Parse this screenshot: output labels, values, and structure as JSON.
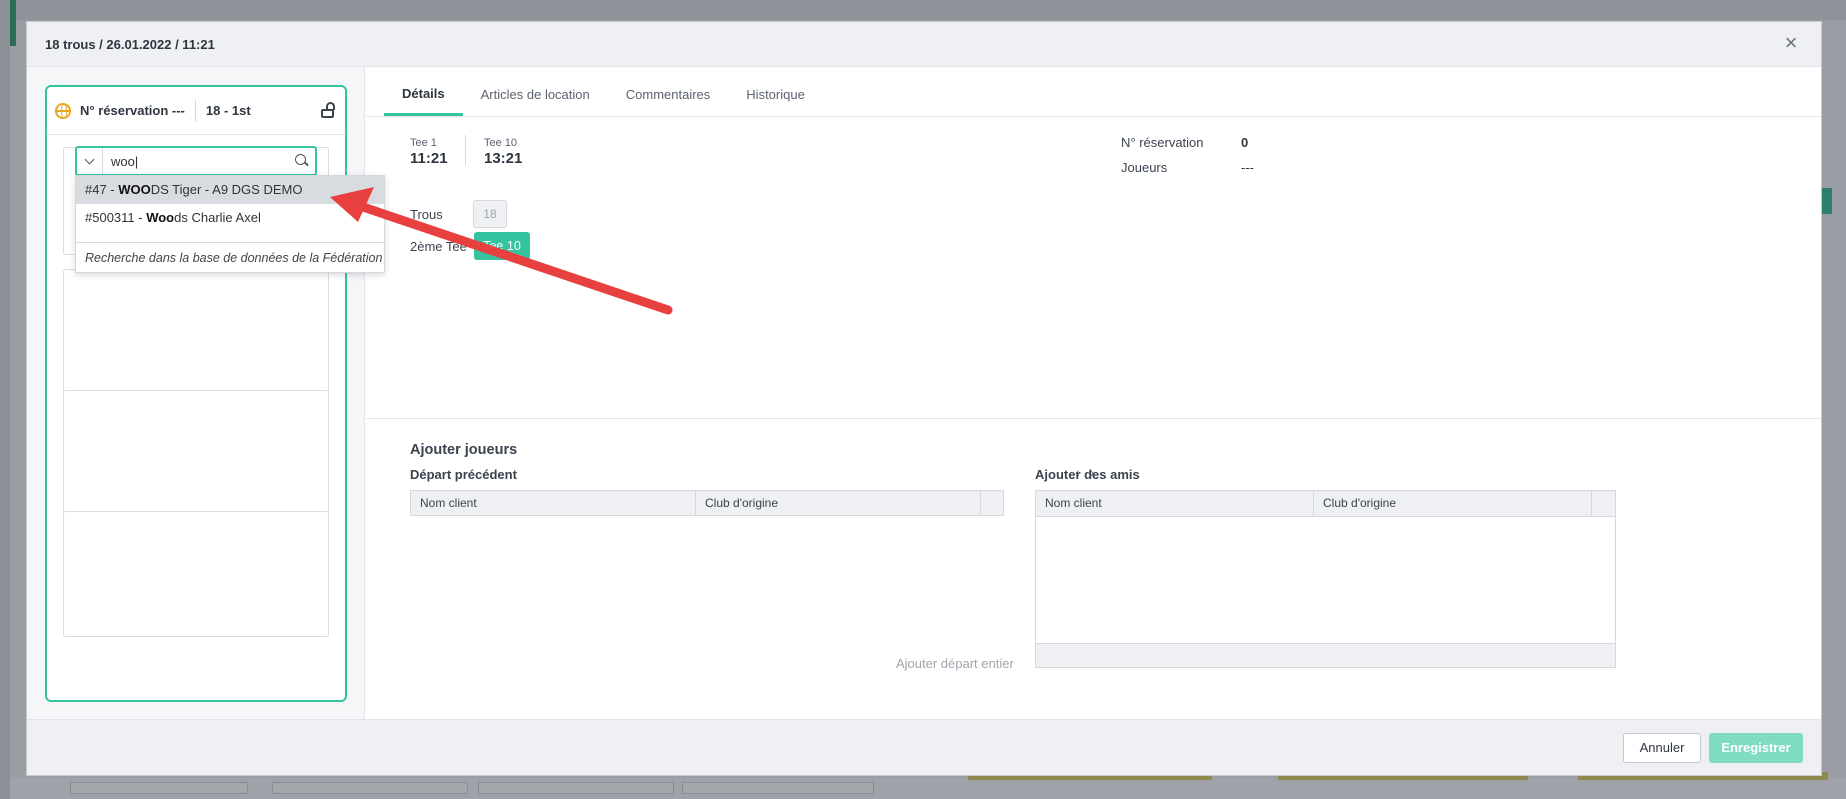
{
  "colors": {
    "accent": "#36c3a0",
    "globe": "#e8a520",
    "arrow": "#e8403f"
  },
  "modal": {
    "title": "18 trous / 26.01.2022 / 11:21",
    "close_glyph": "×"
  },
  "reservation": {
    "label": "N° réservation ---",
    "code": "18 - 1st",
    "search": {
      "value": "woo",
      "results": [
        {
          "id_prefix": "#47 - ",
          "match": "WOO",
          "rest": "DS Tiger - A9 DGS DEMO"
        },
        {
          "id_prefix": "#500311 - ",
          "match": "Woo",
          "rest": "ds Charlie Axel"
        }
      ],
      "federation_search": "Recherche dans la base de données de la Fédération"
    }
  },
  "tabs": [
    "Détails",
    "Articles de location",
    "Commentaires",
    "Historique"
  ],
  "details": {
    "tee1_label": "Tee 1",
    "tee1_time": "11:21",
    "tee10_label": "Tee 10",
    "tee10_time": "13:21",
    "trous_label": "Trous",
    "trous_value": "18",
    "second_tee_label": "2ème Tee",
    "second_tee_button": "Tee 10",
    "booking_no_label": "N° réservation",
    "booking_no_value": "0",
    "players_label": "Joueurs",
    "players_value": "---"
  },
  "add_players": {
    "title": "Ajouter joueurs",
    "previous_title": "Départ précédent",
    "friends_title": "Ajouter des amis",
    "col_name": "Nom client",
    "col_club": "Club d'origine",
    "add_all": "Ajouter départ entier",
    "prev_glyph": "‹",
    "next_glyph": "›"
  },
  "footer": {
    "cancel": "Annuler",
    "save": "Enregistrer"
  }
}
